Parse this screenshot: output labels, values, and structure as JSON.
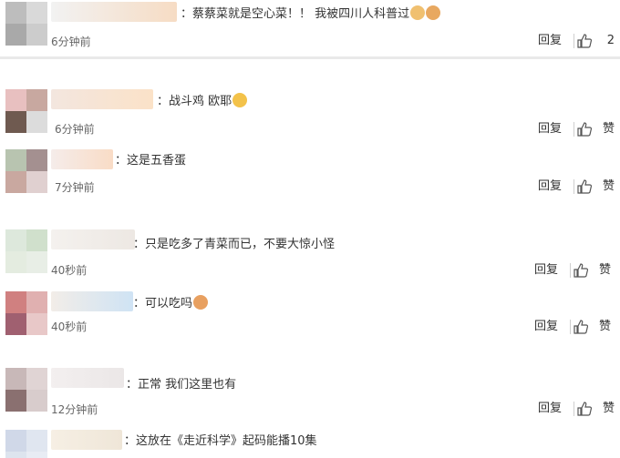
{
  "comments": [
    {
      "text": "：蔡蔡菜就是空心菜！！ 我被四川人科普过",
      "time": "6分钟前",
      "reply": "回复",
      "likes": "2",
      "avatar": [
        "#bdbdbd",
        "#d9d9d9",
        "#a9a9a9",
        "#cccccc"
      ],
      "name_colors": [
        "#f2f2f2",
        "#f6dcc4"
      ],
      "emoji": [
        "#f0c070",
        "#e8a860"
      ]
    },
    {
      "text": "：战斗鸡  欧耶",
      "time": "6分钟前",
      "reply": "回复",
      "likes": "赞",
      "avatar": [
        "#e8c0c0",
        "#c8a8a0",
        "#6f5a50",
        "#dcdcdc"
      ],
      "name_colors": [
        "#f3e6df",
        "#fbe2c8"
      ],
      "emoji": [
        "#f3c24a"
      ]
    },
    {
      "text": "：这是五香蛋",
      "time": "7分钟前",
      "reply": "回复",
      "likes": "赞",
      "avatar": [
        "#b8c4b0",
        "#a49090",
        "#c9a8a0",
        "#e0d0d0"
      ],
      "name_colors": [
        "#f5ecea",
        "#f9dcc6"
      ],
      "emoji": []
    },
    {
      "text": "：只是吃多了青菜而已，不要大惊小怪",
      "time": "40秒前",
      "reply": "回复",
      "likes": "赞",
      "avatar": [
        "#dde8dc",
        "#d0e0cc",
        "#e4ece0",
        "#e8eee6"
      ],
      "name_colors": [
        "#f4f1ee",
        "#ede8e3"
      ],
      "emoji": []
    },
    {
      "text": "：可以吃吗",
      "time": "40秒前",
      "reply": "回复",
      "likes": "赞",
      "avatar": [
        "#d08080",
        "#e0b0b0",
        "#a06070",
        "#e8c8c8"
      ],
      "name_colors": [
        "#f2ede8",
        "#cfe3f4"
      ],
      "emoji": [
        "#e8a060"
      ]
    },
    {
      "text": "：正常  我们这里也有",
      "time": "12分钟前",
      "reply": "回复",
      "likes": "赞",
      "avatar": [
        "#c8b8b8",
        "#e0d4d4",
        "#8a7070",
        "#d8cccc"
      ],
      "name_colors": [
        "#f3efef",
        "#ebe7e7"
      ],
      "emoji": []
    },
    {
      "text": "：这放在《走近科学》起码能播10集",
      "time": "",
      "reply": "",
      "likes": "",
      "avatar": [
        "#d0d8e8",
        "#e0e6f0",
        "#dde4ee",
        "#e8ecf4"
      ],
      "name_colors": [
        "#f6efe4",
        "#efe6d8"
      ],
      "emoji": []
    }
  ]
}
